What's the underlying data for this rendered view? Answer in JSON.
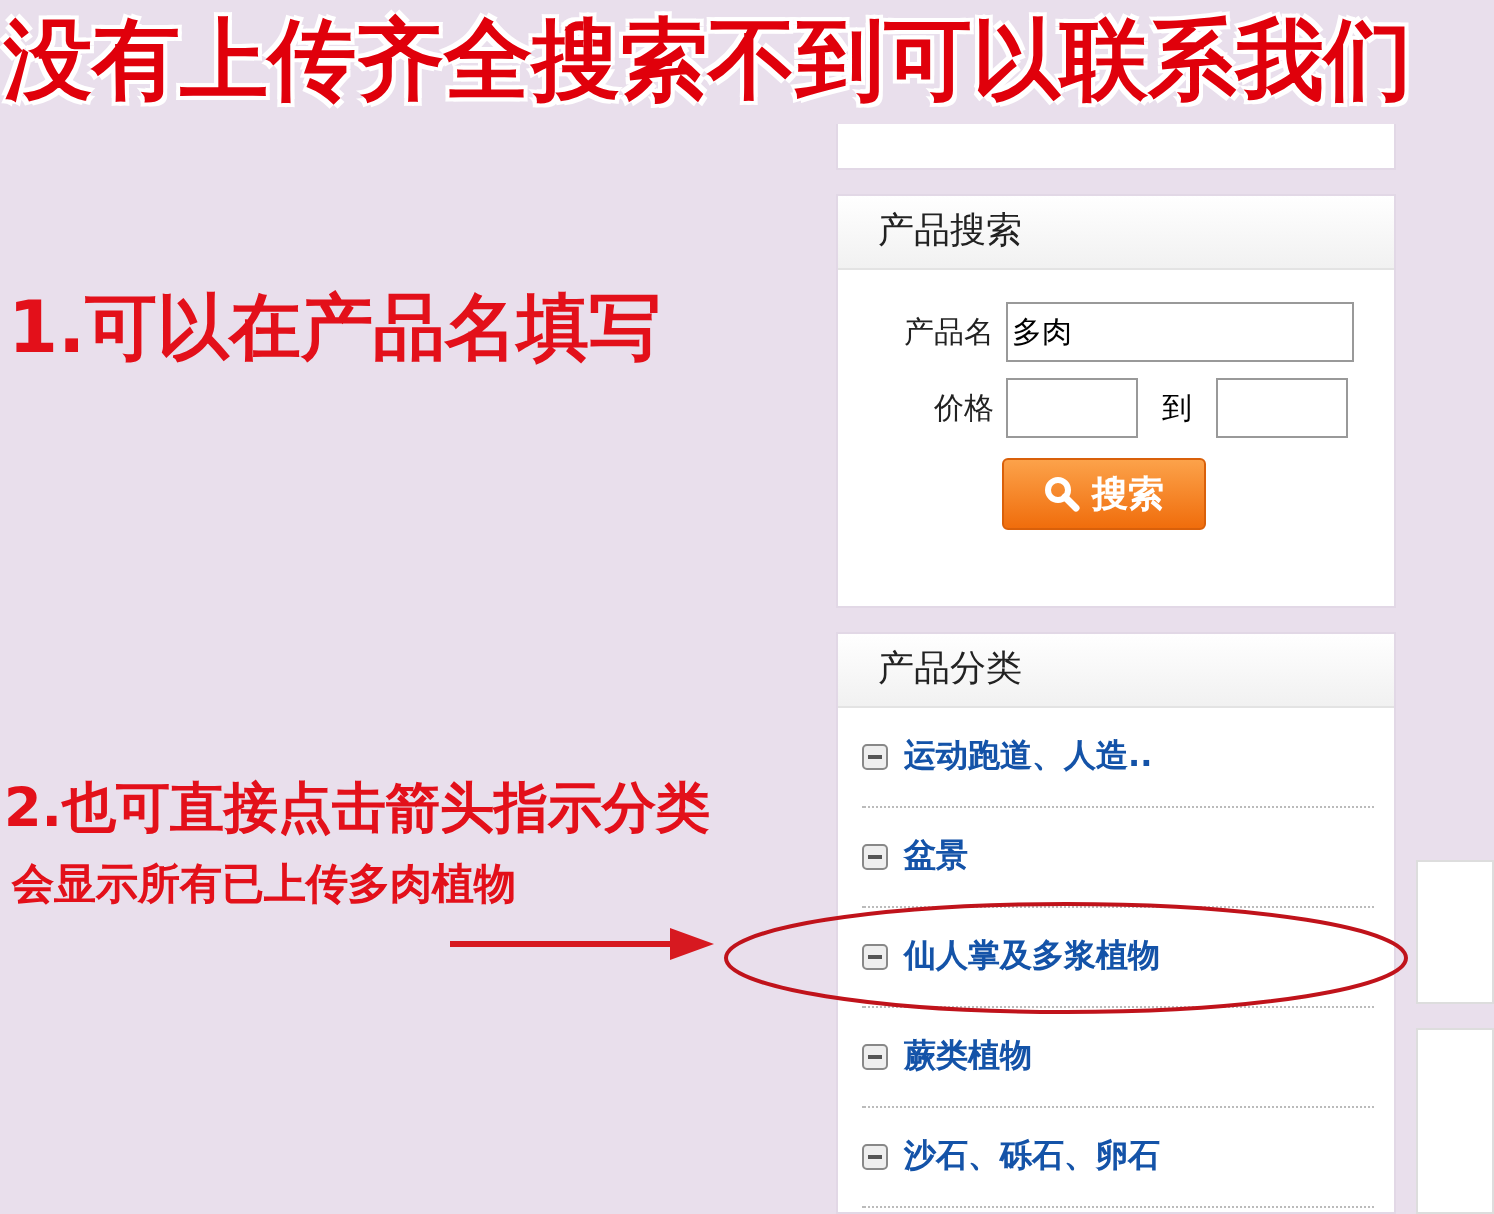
{
  "banner": {
    "text": "没有上传齐全搜索不到可以联系我们"
  },
  "annotations": [
    {
      "kind": "large",
      "text": "1.可以在产品名填写"
    },
    {
      "kind": "medium",
      "text": "2.也可直接点击箭头指示分类"
    },
    {
      "kind": "small",
      "text": "会显示所有已上传多肉植物"
    }
  ],
  "search_panel": {
    "title": "产品搜索",
    "product_name_label": "产品名",
    "product_name_value": "多肉",
    "price_label": "价格",
    "price_to_label": "到",
    "button": "搜索"
  },
  "category_panel": {
    "title": "产品分类",
    "items": [
      {
        "label": "运动跑道、人造..",
        "highlighted": false
      },
      {
        "label": "盆景",
        "highlighted": false
      },
      {
        "label": "仙人掌及多浆植物",
        "highlighted": true
      },
      {
        "label": "蕨类植物",
        "highlighted": false
      },
      {
        "label": "沙石、砾石、卵石",
        "highlighted": false
      }
    ]
  }
}
